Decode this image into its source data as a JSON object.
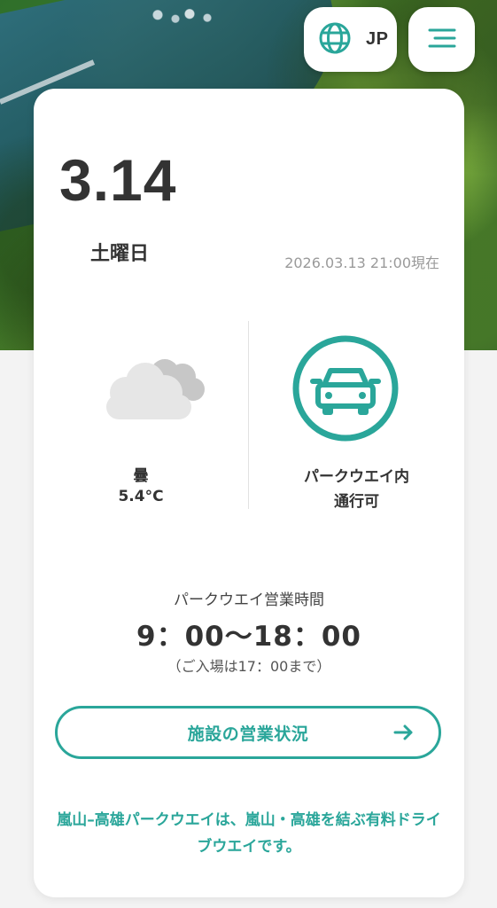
{
  "header": {
    "language": "JP",
    "language_icon": "globe-icon",
    "menu_icon": "hamburger-menu-icon"
  },
  "status": {
    "date": "3.14",
    "weekday": "土曜日",
    "updated_at": "2026.03.13 21:00現在"
  },
  "weather": {
    "condition": "曇",
    "temperature": "5.4°C",
    "icon": "cloud-icon"
  },
  "traffic": {
    "area": "パークウエイ内",
    "status": "通行可",
    "icon": "car-icon"
  },
  "hours": {
    "title": "パークウエイ営業時間",
    "time": "9：00〜18：00",
    "note": "（ご入場は17：00まで）"
  },
  "actions": {
    "facility_status_label": "施設の営業状況",
    "facility_status_icon": "arrow-right-icon"
  },
  "description": "嵐山–高雄パークウエイは、嵐山・高雄を結ぶ有料ドライブウエイです。",
  "colors": {
    "accent": "#2aa69a",
    "text": "#333333"
  }
}
